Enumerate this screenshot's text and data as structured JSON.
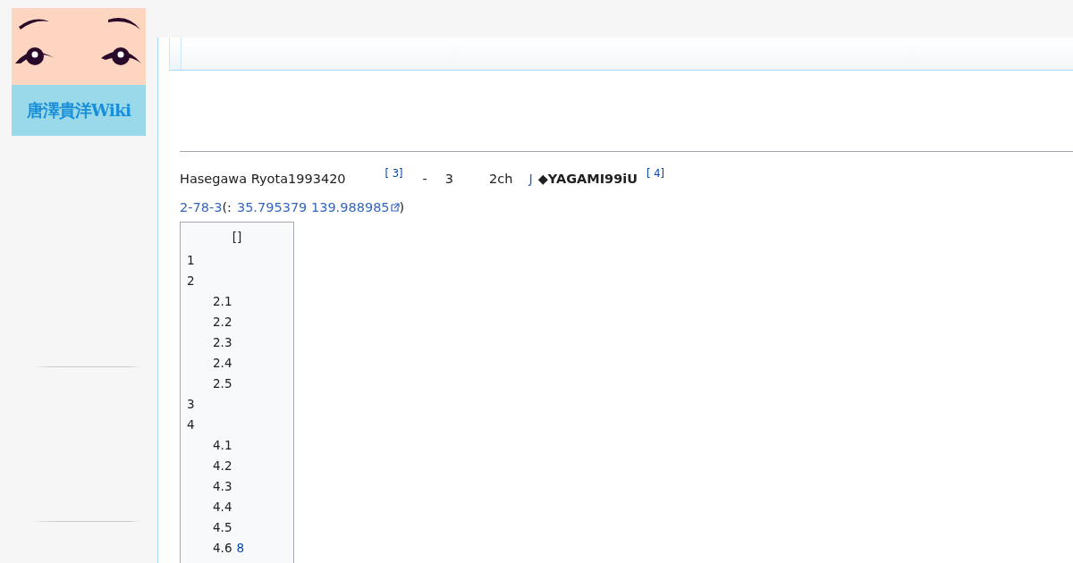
{
  "logo": {
    "text": "唐澤貴洋Wiki"
  },
  "intro": [
    {
      "kind": "text",
      "text": "Hasegawa Ryota1993420"
    },
    {
      "kind": "ref",
      "text": "[ 3]"
    },
    {
      "kind": "text",
      "text": "-"
    },
    {
      "kind": "text",
      "text": "3"
    },
    {
      "kind": "text",
      "text": "2ch"
    },
    {
      "kind": "link",
      "text": "J"
    },
    {
      "kind": "bold",
      "text": "◆YAGAMI99iU"
    },
    {
      "kind": "ref",
      "text": "[ 4]"
    }
  ],
  "location": [
    {
      "kind": "link",
      "text": "2-78-3"
    },
    {
      "kind": "text",
      "text": "(:"
    },
    {
      "kind": "extlink",
      "text": "35.795379 139.988985"
    },
    {
      "kind": "text",
      "text": ")"
    }
  ],
  "toc": {
    "title": "[]",
    "items": [
      {
        "number": "1"
      },
      {
        "number": "2",
        "children": [
          {
            "number": "2.1"
          },
          {
            "number": "2.2"
          },
          {
            "number": "2.3"
          },
          {
            "number": "2.4"
          },
          {
            "number": "2.5"
          }
        ]
      },
      {
        "number": "3"
      },
      {
        "number": "4",
        "children": [
          {
            "number": "4.1"
          },
          {
            "number": "4.2"
          },
          {
            "number": "4.3"
          },
          {
            "number": "4.4"
          },
          {
            "number": "4.5"
          },
          {
            "number": "4.6",
            "link": "8"
          }
        ]
      }
    ]
  }
}
